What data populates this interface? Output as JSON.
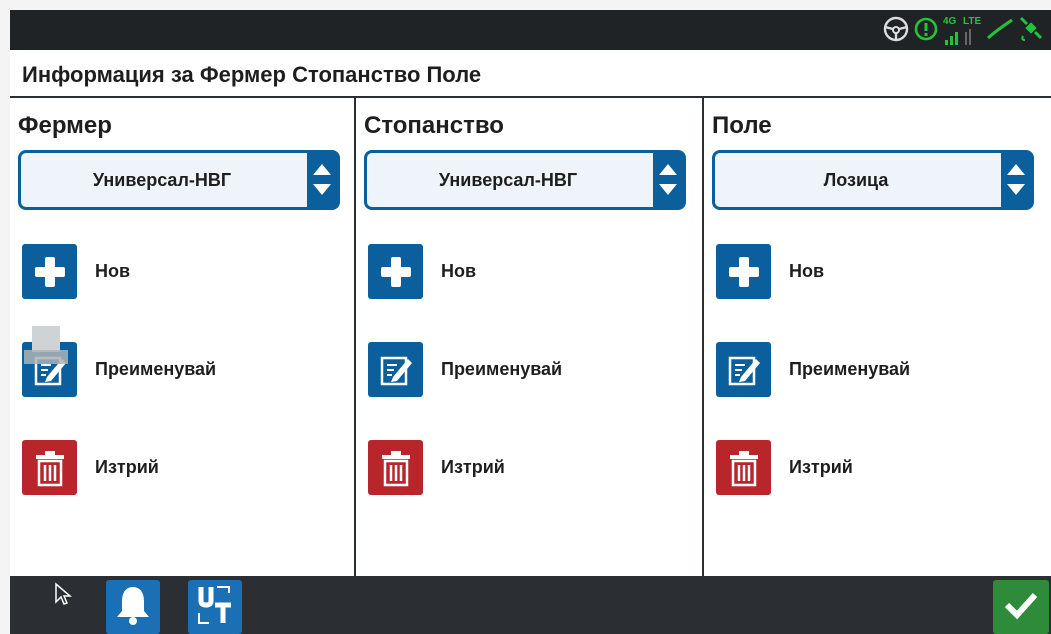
{
  "app": {
    "title": "Информация за Фермер Стопанство Поле"
  },
  "colors": {
    "accent": "#0a5f9c",
    "danger": "#b8262c",
    "ok": "#2e8b3a",
    "status_green": "#22c53a"
  },
  "status": {
    "network_label": "4G",
    "lte_label": "LTE"
  },
  "columns": [
    {
      "heading": "Фермер",
      "selected": "Универсал-НВГ",
      "actions": {
        "new": "Нов",
        "rename": "Преименувай",
        "delete": "Изтрий"
      }
    },
    {
      "heading": "Стопанство",
      "selected": "Универсал-НВГ",
      "actions": {
        "new": "Нов",
        "rename": "Преименувай",
        "delete": "Изтрий"
      }
    },
    {
      "heading": "Поле",
      "selected": "Лозица",
      "actions": {
        "new": "Нов",
        "rename": "Преименувай",
        "delete": "Изтрий"
      }
    }
  ],
  "icons": [
    "steering-wheel-icon",
    "gps-icon",
    "signal-icon",
    "guidance-line-icon",
    "satellite-icon",
    "plus-icon",
    "edit-icon",
    "trash-icon",
    "bell-icon",
    "ut-icon",
    "checkmark-icon",
    "cursor-icon"
  ]
}
